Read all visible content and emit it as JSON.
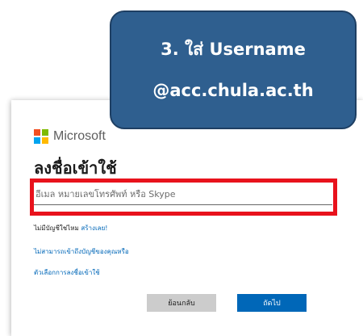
{
  "callout": {
    "line1": "3. ใส่ Username",
    "line2": "@acc.chula.ac.th",
    "color": "#2f5f8f"
  },
  "login": {
    "brand": "Microsoft",
    "brand_colors": [
      "#f25022",
      "#7fba00",
      "#00a4ef",
      "#ffb900"
    ],
    "title": "ลงชื่อเข้าใช้",
    "email_placeholder": "อีเมล หมายเลขโทรศัพท์ หรือ Skype",
    "no_account_text": "ไม่มีบัญชีใช่ไหม",
    "create_link": "สร้างเลย!",
    "cant_access_link": "ไม่สามารถเข้าถึงบัญชีของคุณหรือ",
    "signin_options_link": "ตัวเลือกการลงชื่อเข้าใช้",
    "back_button": "ย้อนกลับ",
    "next_button": "ถัดไป",
    "accent_color": "#0067b8",
    "highlight_color": "#e8121c"
  }
}
